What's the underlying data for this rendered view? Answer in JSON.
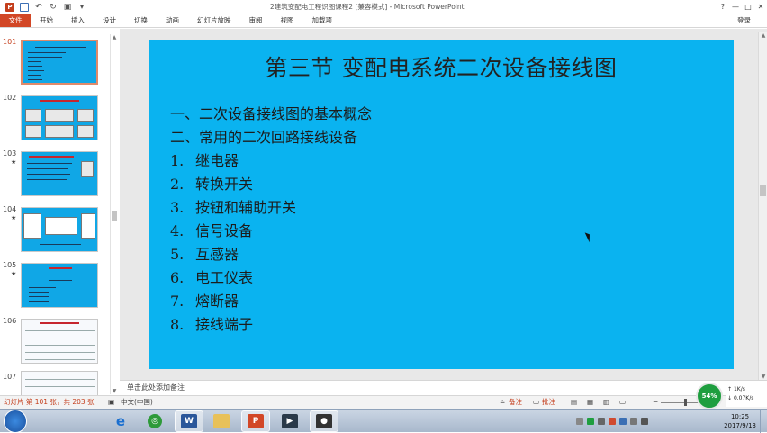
{
  "window": {
    "title": "2建筑变配电工程识图课程2 [兼容模式] - Microsoft PowerPoint",
    "controls": [
      "?",
      "—",
      "□",
      "✕"
    ]
  },
  "quick_access": {
    "app_icon_letter": "P",
    "icons": [
      "powerpoint-icon",
      "save-icon",
      "undo-icon",
      "redo-icon",
      "start-from-beginning-icon",
      "customize-icon"
    ]
  },
  "ribbon": {
    "tabs": [
      "文件",
      "开始",
      "插入",
      "设计",
      "切换",
      "动画",
      "幻灯片放映",
      "审阅",
      "视图",
      "加载项"
    ],
    "login": "登录"
  },
  "thumbnails": [
    {
      "number": "101",
      "star": "",
      "active": true
    },
    {
      "number": "102",
      "star": "",
      "active": false
    },
    {
      "number": "103",
      "star": "★",
      "active": false
    },
    {
      "number": "104",
      "star": "★",
      "active": false
    },
    {
      "number": "105",
      "star": "★",
      "active": false
    },
    {
      "number": "106",
      "star": "",
      "active": false
    },
    {
      "number": "107",
      "star": "",
      "active": false
    }
  ],
  "slide": {
    "title": "第三节  变配电系统二次设备接线图",
    "items": [
      {
        "num": "",
        "text": "一、二次设备接线图的基本概念"
      },
      {
        "num": "",
        "text": "二、常用的二次回路接线设备"
      },
      {
        "num": "1.",
        "text": "继电器"
      },
      {
        "num": "2.",
        "text": "转换开关"
      },
      {
        "num": "3.",
        "text": "按钮和辅助开关"
      },
      {
        "num": "4.",
        "text": "信号设备"
      },
      {
        "num": "5.",
        "text": "互感器"
      },
      {
        "num": "6.",
        "text": "电工仪表"
      },
      {
        "num": "7.",
        "text": "熔断器"
      },
      {
        "num": "8.",
        "text": "接线端子"
      }
    ],
    "background": "#0ab3f0"
  },
  "notes": {
    "placeholder": "单击此处添加备注"
  },
  "status_bar": {
    "slide_info": "幻灯片 第 101 张，共 203 张",
    "language": "中文(中国)",
    "notes_button": "备注",
    "comments_button": "批注"
  },
  "network_widget": {
    "percent": "54%",
    "up": "1K/s",
    "down": "0.07K/s"
  },
  "taskbar": {
    "apps": [
      "ie-icon",
      "chrome-icon",
      "word-icon",
      "explorer-icon",
      "powerpoint-icon",
      "media-icon",
      "screen-recorder-icon"
    ],
    "time": "10:25",
    "date": "2017/9/13"
  },
  "colors": {
    "accent": "#d24726",
    "slide_bg": "#0ab3f0",
    "taskbar": "#b8c6d8"
  }
}
